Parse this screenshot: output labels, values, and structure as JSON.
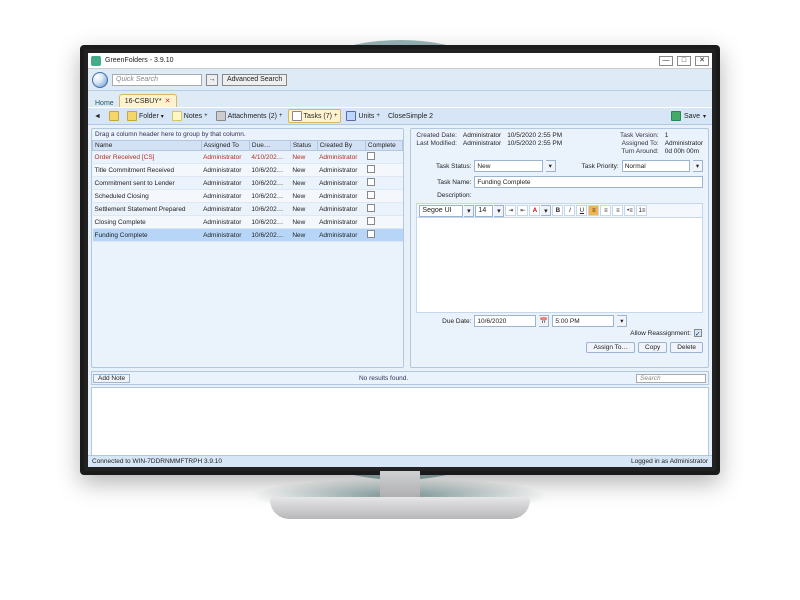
{
  "window": {
    "title": "GreenFolders - 3.9.10"
  },
  "search": {
    "placeholder": "Quick Search",
    "advanced": "Advanced Search"
  },
  "tabs": {
    "home": "Home",
    "file": "16-CSBUY*"
  },
  "toolbar": {
    "folder": "Folder",
    "notes": "Notes",
    "attachments": "Attachments (2)",
    "tasks": "Tasks (7)",
    "units": "Units",
    "closesimple": "CloseSimple 2",
    "save": "Save"
  },
  "grid": {
    "group_hint": "Drag a column header here to group by that column.",
    "cols": [
      "Name",
      "Assigned To",
      "Due…",
      "Status",
      "Created By",
      "Complete"
    ],
    "rows": [
      {
        "name": "Order Received [CS]",
        "assigned": "Administrator",
        "due": "4/10/202…",
        "status": "New",
        "created": "Administrator",
        "red": true
      },
      {
        "name": "Title Commitment Received",
        "assigned": "Administrator",
        "due": "10/6/202…",
        "status": "New",
        "created": "Administrator"
      },
      {
        "name": "Commitment sent to Lender",
        "assigned": "Administrator",
        "due": "10/6/202…",
        "status": "New",
        "created": "Administrator"
      },
      {
        "name": "Scheduled Closing",
        "assigned": "Administrator",
        "due": "10/6/202…",
        "status": "New",
        "created": "Administrator"
      },
      {
        "name": "Settlement Statement Prepared",
        "assigned": "Administrator",
        "due": "10/6/202…",
        "status": "New",
        "created": "Administrator"
      },
      {
        "name": "Closing Complete",
        "assigned": "Administrator",
        "due": "10/6/202…",
        "status": "New",
        "created": "Administrator"
      },
      {
        "name": "Funding Complete",
        "assigned": "Administrator",
        "due": "10/6/202…",
        "status": "New",
        "created": "Administrator",
        "sel": true
      }
    ]
  },
  "details": {
    "created_lbl": "Created Date:",
    "created_by": "Administrator",
    "created_ts": "10/5/2020 2:55 PM",
    "version_lbl": "Task Version:",
    "version": "1",
    "mod_lbl": "Last Modified:",
    "mod_by": "Administrator",
    "mod_ts": "10/5/2020 2:55 PM",
    "assigned_lbl": "Assigned To:",
    "assigned": "Administrator",
    "turn_lbl": "Turn Around:",
    "turn": "0d 00h 00m",
    "status_lbl": "Task Status:",
    "status": "New",
    "priority_lbl": "Task Priority:",
    "priority": "Normal",
    "name_lbl": "Task Name:",
    "name": "Funding Complete",
    "desc_lbl": "Description:",
    "font": "Segoe UI",
    "size": "14",
    "due_lbl": "Due Date:",
    "due_date": "10/6/2020",
    "due_time": "5:00 PM",
    "reassign": "Allow Reassignment:",
    "assign_btn": "Assign To…",
    "copy_btn": "Copy",
    "delete_btn": "Delete"
  },
  "notes": {
    "add": "Add Note",
    "none": "No results found.",
    "search": "Search"
  },
  "status": {
    "conn": "Connected to WIN-7DDRNMMFTRPH 3.9.10",
    "login": "Logged in as Administrator"
  }
}
